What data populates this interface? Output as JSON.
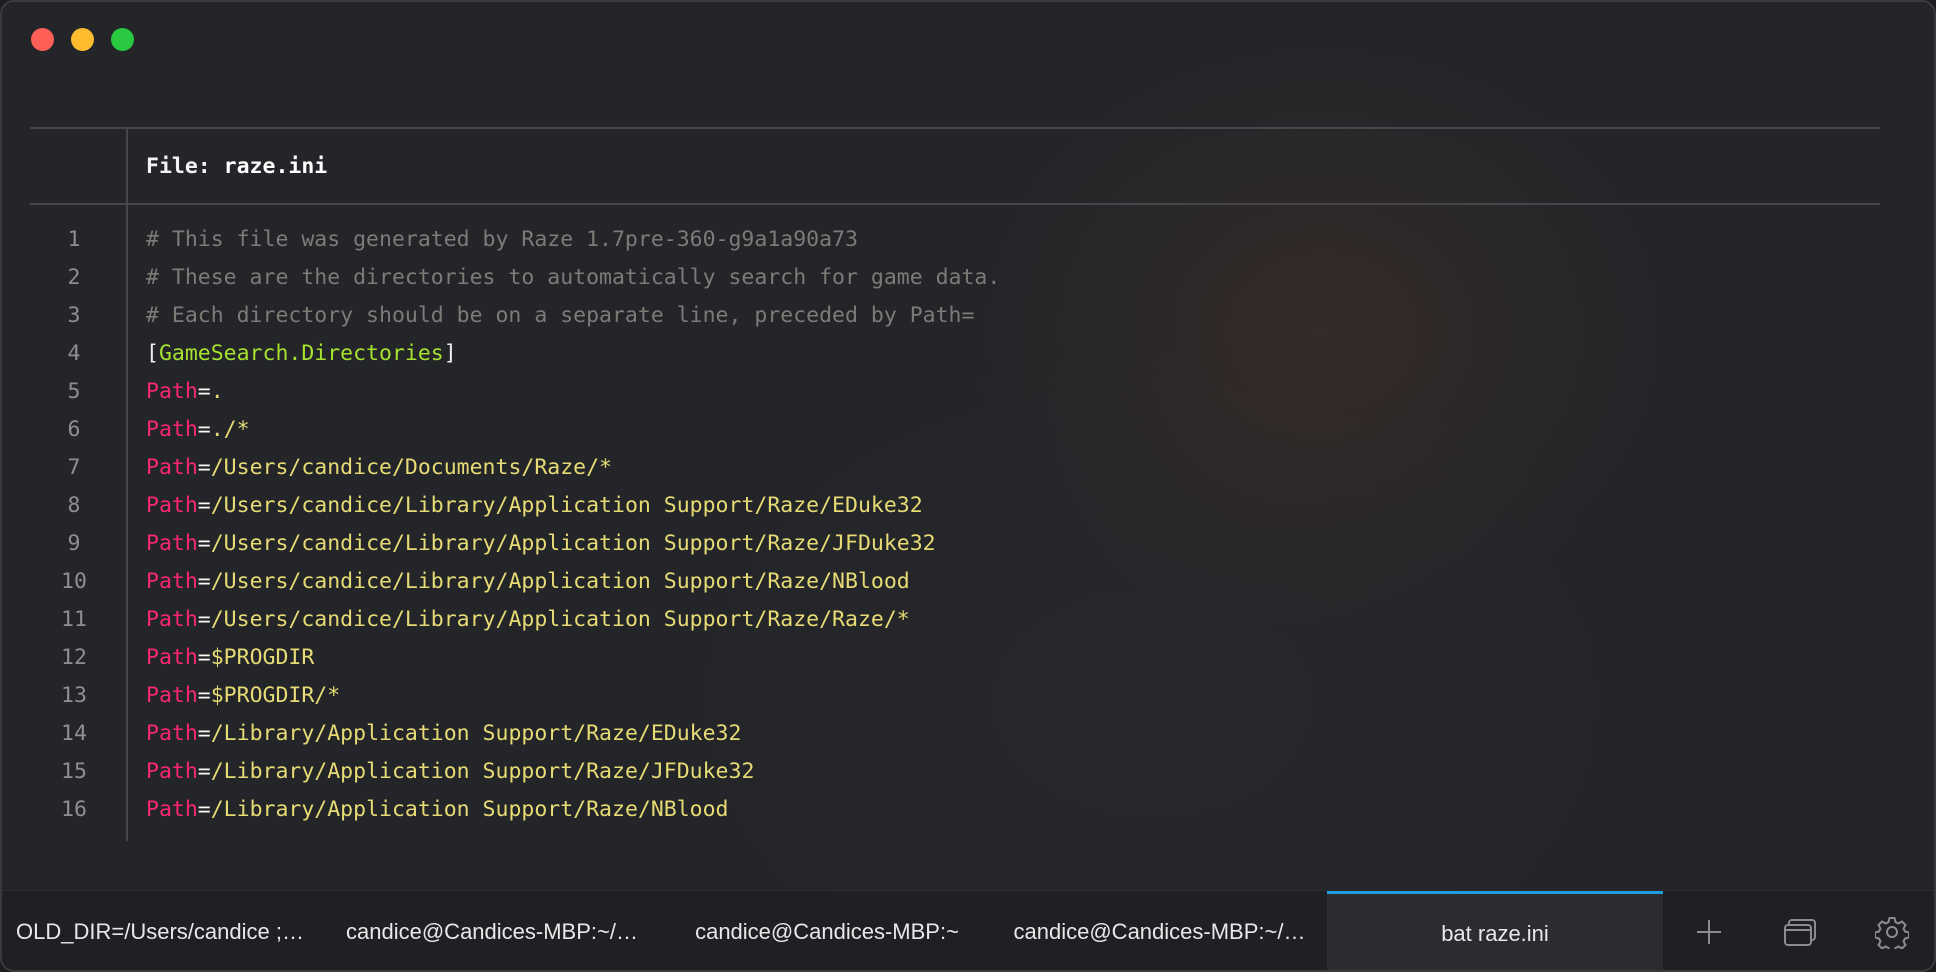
{
  "window": {
    "controls": [
      "close",
      "minimize",
      "maximize"
    ]
  },
  "file_header": {
    "label": "File: ",
    "filename": "raze.ini"
  },
  "lines": [
    {
      "n": "1",
      "parts": [
        {
          "t": "# This file was generated by Raze 1.7pre-360-g9a1a90a73",
          "c": "comment"
        }
      ]
    },
    {
      "n": "2",
      "parts": [
        {
          "t": "# These are the directories to automatically search for game data.",
          "c": "comment"
        }
      ]
    },
    {
      "n": "3",
      "parts": [
        {
          "t": "# Each directory should be on a separate line, preceded by Path=",
          "c": "comment"
        }
      ]
    },
    {
      "n": "4",
      "parts": [
        {
          "t": "[",
          "c": "bracket"
        },
        {
          "t": "GameSearch.Directories",
          "c": "section"
        },
        {
          "t": "]",
          "c": "bracket"
        }
      ]
    },
    {
      "n": "5",
      "parts": [
        {
          "t": "Path",
          "c": "key"
        },
        {
          "t": "=",
          "c": "eq"
        },
        {
          "t": ".",
          "c": "val"
        }
      ]
    },
    {
      "n": "6",
      "parts": [
        {
          "t": "Path",
          "c": "key"
        },
        {
          "t": "=",
          "c": "eq"
        },
        {
          "t": "./*",
          "c": "val"
        }
      ]
    },
    {
      "n": "7",
      "parts": [
        {
          "t": "Path",
          "c": "key"
        },
        {
          "t": "=",
          "c": "eq"
        },
        {
          "t": "/Users/candice/Documents/Raze/*",
          "c": "val"
        }
      ]
    },
    {
      "n": "8",
      "parts": [
        {
          "t": "Path",
          "c": "key"
        },
        {
          "t": "=",
          "c": "eq"
        },
        {
          "t": "/Users/candice/Library/Application Support/Raze/EDuke32",
          "c": "val"
        }
      ]
    },
    {
      "n": "9",
      "parts": [
        {
          "t": "Path",
          "c": "key"
        },
        {
          "t": "=",
          "c": "eq"
        },
        {
          "t": "/Users/candice/Library/Application Support/Raze/JFDuke32",
          "c": "val"
        }
      ]
    },
    {
      "n": "10",
      "parts": [
        {
          "t": "Path",
          "c": "key"
        },
        {
          "t": "=",
          "c": "eq"
        },
        {
          "t": "/Users/candice/Library/Application Support/Raze/NBlood",
          "c": "val"
        }
      ]
    },
    {
      "n": "11",
      "parts": [
        {
          "t": "Path",
          "c": "key"
        },
        {
          "t": "=",
          "c": "eq"
        },
        {
          "t": "/Users/candice/Library/Application Support/Raze/Raze/*",
          "c": "val"
        }
      ]
    },
    {
      "n": "12",
      "parts": [
        {
          "t": "Path",
          "c": "key"
        },
        {
          "t": "=",
          "c": "eq"
        },
        {
          "t": "$PROGDIR",
          "c": "val"
        }
      ]
    },
    {
      "n": "13",
      "parts": [
        {
          "t": "Path",
          "c": "key"
        },
        {
          "t": "=",
          "c": "eq"
        },
        {
          "t": "$PROGDIR/*",
          "c": "val"
        }
      ]
    },
    {
      "n": "14",
      "parts": [
        {
          "t": "Path",
          "c": "key"
        },
        {
          "t": "=",
          "c": "eq"
        },
        {
          "t": "/Library/Application Support/Raze/EDuke32",
          "c": "val"
        }
      ]
    },
    {
      "n": "15",
      "parts": [
        {
          "t": "Path",
          "c": "key"
        },
        {
          "t": "=",
          "c": "eq"
        },
        {
          "t": "/Library/Application Support/Raze/JFDuke32",
          "c": "val"
        }
      ]
    },
    {
      "n": "16",
      "parts": [
        {
          "t": "Path",
          "c": "key"
        },
        {
          "t": "=",
          "c": "eq"
        },
        {
          "t": "/Library/Application Support/Raze/NBlood",
          "c": "val"
        }
      ]
    }
  ],
  "tabs": [
    {
      "label": "OLD_DIR=/Users/candice ; …",
      "active": false
    },
    {
      "label": "candice@Candices-MBP:~/…",
      "active": false
    },
    {
      "label": "candice@Candices-MBP:~",
      "active": false
    },
    {
      "label": "candice@Candices-MBP:~/…",
      "active": false
    },
    {
      "label": "bat raze.ini",
      "active": true
    }
  ],
  "tab_actions": [
    {
      "name": "new-tab-icon",
      "glyph": "plus"
    },
    {
      "name": "tab-overview-icon",
      "glyph": "windows"
    },
    {
      "name": "settings-icon",
      "glyph": "gear"
    }
  ],
  "colors": {
    "accent": "#1e9ce0",
    "comment": "#7b7c78",
    "key": "#f92672",
    "value": "#e6db74",
    "section": "#a6e22e"
  }
}
